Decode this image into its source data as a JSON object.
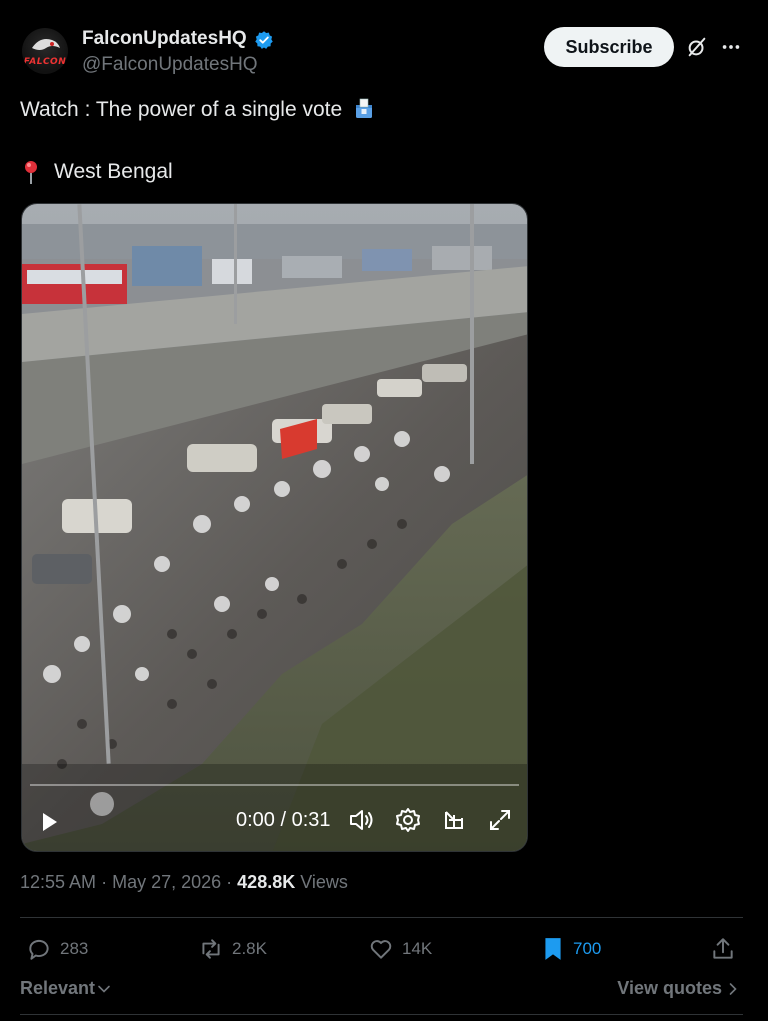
{
  "author": {
    "display_name": "FalconUpdatesHQ",
    "handle": "@FalconUpdatesHQ",
    "avatar_text": "FALCON",
    "verified_icon": "verified-badge-icon",
    "verified_color": "#1d9bf0"
  },
  "header": {
    "subscribe_label": "Subscribe",
    "grok_icon": "grok-icon",
    "more_icon": "more-icon"
  },
  "tweet": {
    "text": "Watch : The power of a single vote",
    "text_emoji": "ballot-box-icon",
    "location_emoji": "pin-icon",
    "location": "West Bengal"
  },
  "video": {
    "time": "0:00 / 0:31",
    "progress": 0,
    "play_icon": "play-icon",
    "volume_icon": "volume-icon",
    "settings_icon": "settings-icon",
    "pip_icon": "pip-icon",
    "fullscreen_icon": "fullscreen-icon"
  },
  "meta": {
    "time": "12:55 AM",
    "date": "May 27, 2026",
    "views_count": "428.8K",
    "views_label": "Views"
  },
  "actions": {
    "replies": "283",
    "reposts": "2.8K",
    "likes": "14K",
    "bookmarks": "700",
    "accent": "#1d9bf0"
  },
  "footer": {
    "sort_label": "Relevant",
    "view_quotes_label": "View quotes"
  }
}
